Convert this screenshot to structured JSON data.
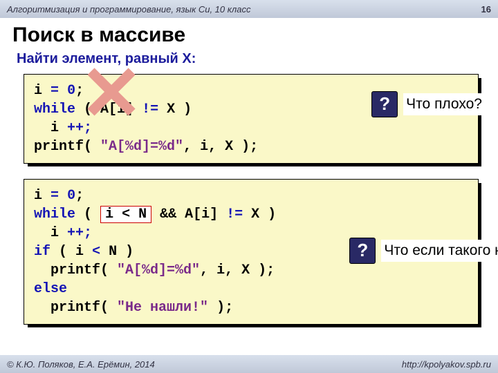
{
  "topbar": {
    "title": "Алгоритмизация и программирование, язык Си, 10 класс",
    "page": "16"
  },
  "heading": "Поиск в массиве",
  "task": "Найти элемент, равный X:",
  "block1": {
    "l1": {
      "a": "i",
      "b": "=",
      "c": "0",
      "d": ";"
    },
    "l2": {
      "a": "while",
      "b": "( A[i]",
      "c": "!=",
      "d": "X )"
    },
    "l3": {
      "a": "  i",
      "b": "++;"
    },
    "l4": {
      "a": "printf",
      "b": "( ",
      "c": "\"A[%d]=%d\"",
      "d": ", i, X );"
    },
    "callout": "Что плохо?"
  },
  "block2": {
    "l1": {
      "a": "i",
      "b": "=",
      "c": "0",
      "d": ";"
    },
    "l2": {
      "a": "while",
      "b": "(",
      "hl": "i < N",
      "c": "  &&   A[i]",
      "d": "!=",
      "e": "X )"
    },
    "l3": {
      "a": "  i",
      "b": "++;"
    },
    "l4": {
      "a": "if",
      "b": "( i",
      "c": "<",
      "d": "N )"
    },
    "l5": {
      "a": "  printf",
      "b": "( ",
      "c": "\"A[%d]=%d\"",
      "d": ", i, X );"
    },
    "l6": {
      "a": "else"
    },
    "l7": {
      "a": "  printf",
      "b": "( ",
      "c": "\"Не нашли!\"",
      "d": " );"
    },
    "callout": "Что если такого нет?"
  },
  "footer": {
    "left": "© К.Ю. Поляков, Е.А. Ерёмин, 2014",
    "right": "http://kpolyakov.spb.ru"
  },
  "q": "?"
}
